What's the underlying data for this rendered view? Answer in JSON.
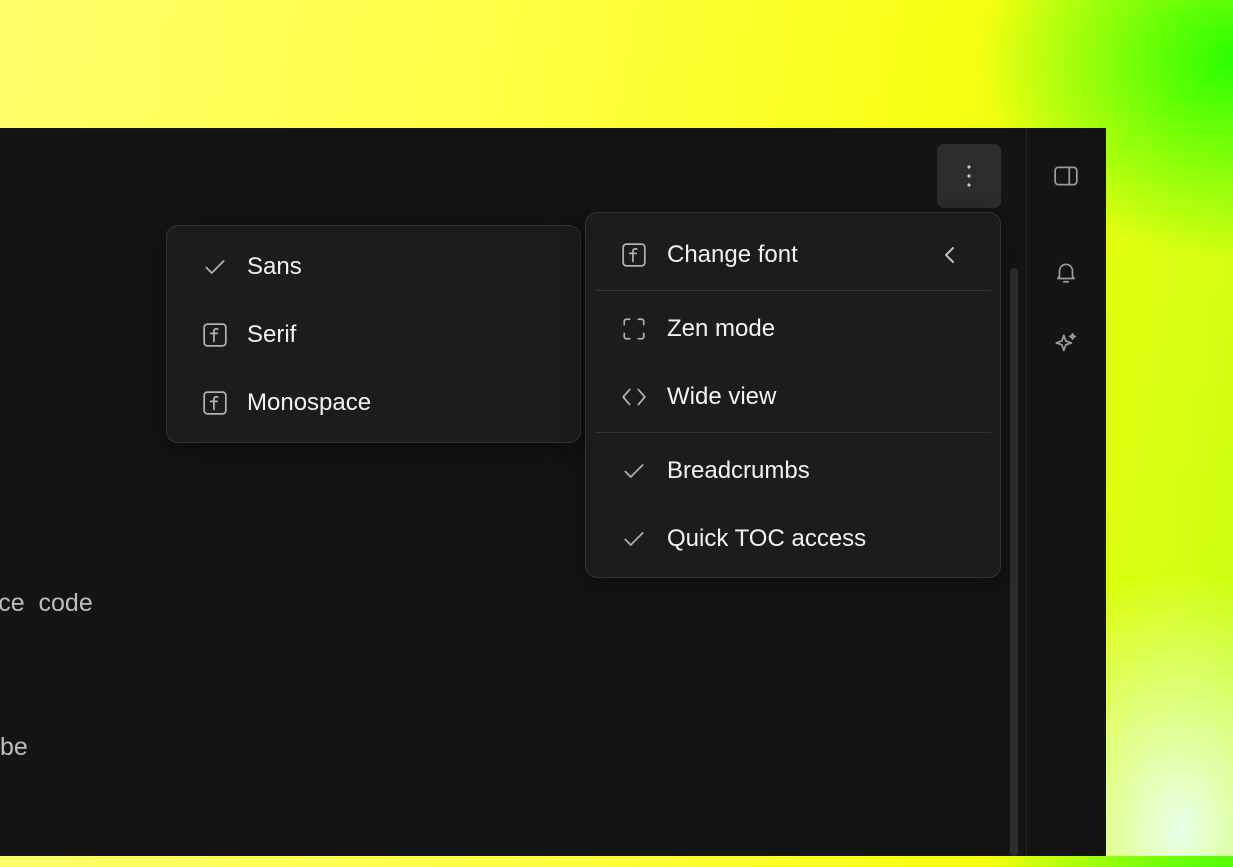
{
  "background_text": {
    "line1": "urce  code",
    "line2": "be"
  },
  "toolbar": {
    "more_icon": "more-vertical-icon"
  },
  "rightbar": {
    "icons": [
      "sidebar-panel-icon",
      "bell-icon",
      "sparkle-icon"
    ]
  },
  "main_menu": {
    "items": [
      {
        "label": "Change font",
        "icon": "font-icon",
        "submenu_open": true
      },
      {
        "label": "Zen mode",
        "icon": "zen-frame-icon"
      },
      {
        "label": "Wide view",
        "icon": "code-brackets-icon"
      },
      {
        "label": "Breadcrumbs",
        "icon": "check-icon",
        "checked": true
      },
      {
        "label": "Quick TOC access",
        "icon": "check-icon",
        "checked": true
      }
    ]
  },
  "font_menu": {
    "items": [
      {
        "label": "Sans",
        "icon": "check-icon",
        "selected": true
      },
      {
        "label": "Serif",
        "icon": "font-icon"
      },
      {
        "label": "Monospace",
        "icon": "font-icon"
      }
    ]
  }
}
